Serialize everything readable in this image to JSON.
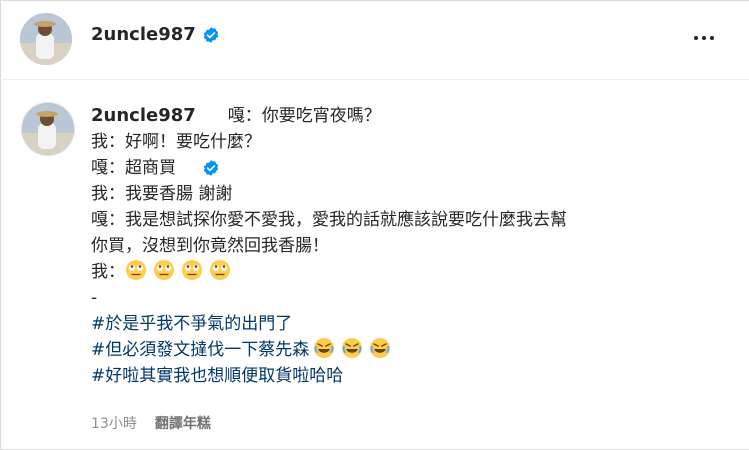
{
  "header": {
    "username": "2uncle987",
    "more_icon": "more-horizontal-icon"
  },
  "post": {
    "username": "2uncle987",
    "first_line": "嘎：你要吃宵夜嗎？",
    "lines": [
      "我：好啊！要吃什麼？",
      "嘎：超商買",
      "我：我要香腸 謝謝",
      "嘎：我是想試探你愛不愛我，愛我的話就應該說要吃什麼我去幫",
      "你買，沒想到你竟然回我香腸！"
    ],
    "emoji_line_prefix": "我：",
    "emoji_line_icons": [
      "face-rolling-eyes-icon",
      "face-rolling-eyes-icon",
      "face-rolling-eyes-icon",
      "face-rolling-eyes-icon"
    ],
    "separator": "-",
    "hashtags": [
      "#於是乎我不爭氣的出門了",
      "#但必須發文撻伐一下蔡先森",
      "#好啦其實我也想順便取貨啦哈哈"
    ],
    "hashtag2_emojis": [
      "rolling-laughing-icon",
      "rolling-laughing-icon",
      "rolling-laughing-icon"
    ],
    "time": "13小時",
    "translate_label": "翻譯年糕"
  },
  "colors": {
    "text": "#262626",
    "hashtag": "#00376b",
    "muted": "#8e8e8e",
    "verified": "#0095f6"
  }
}
